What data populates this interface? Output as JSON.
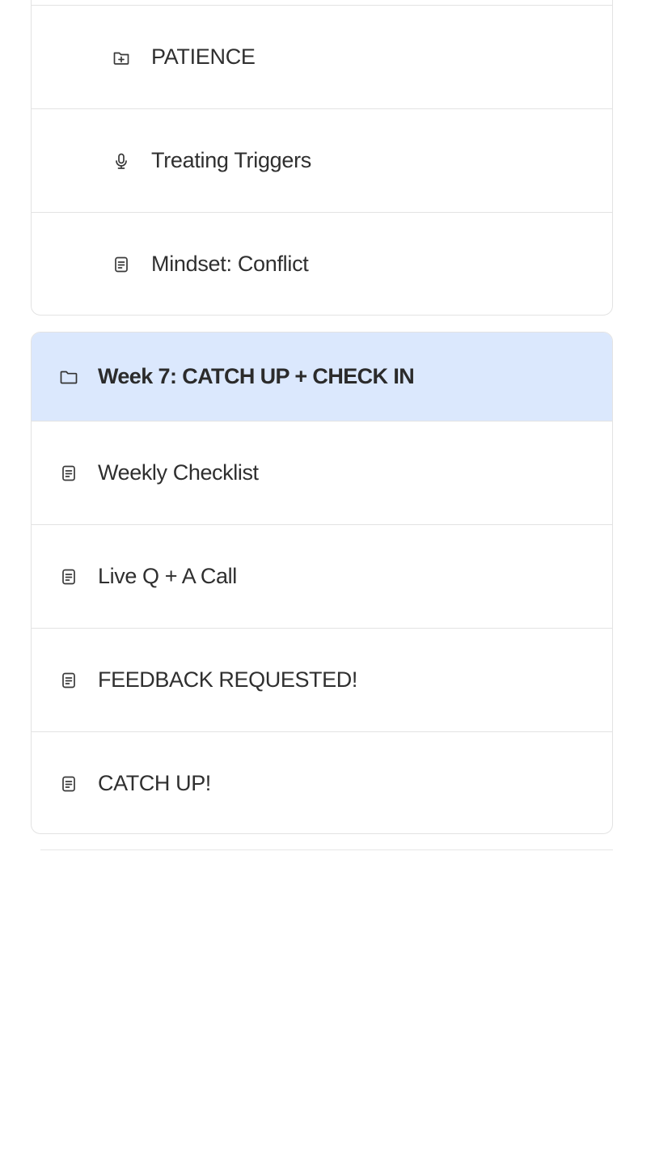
{
  "previous_module": {
    "items": [
      {
        "label": "PATIENCE",
        "icon": "folder-plus-icon"
      },
      {
        "label": "Treating Triggers",
        "icon": "microphone-icon"
      },
      {
        "label": "Mindset: Conflict",
        "icon": "document-icon"
      }
    ]
  },
  "week7": {
    "title": "Week 7: CATCH UP + CHECK IN",
    "icon": "folder-icon",
    "header_color": "#dbe8fd",
    "lessons": [
      {
        "label": "Weekly Checklist",
        "icon": "document-icon"
      },
      {
        "label": "Live Q + A Call",
        "icon": "document-icon"
      },
      {
        "label": "FEEDBACK REQUESTED!",
        "icon": "document-icon"
      },
      {
        "label": "CATCH UP!",
        "icon": "document-icon"
      }
    ]
  }
}
